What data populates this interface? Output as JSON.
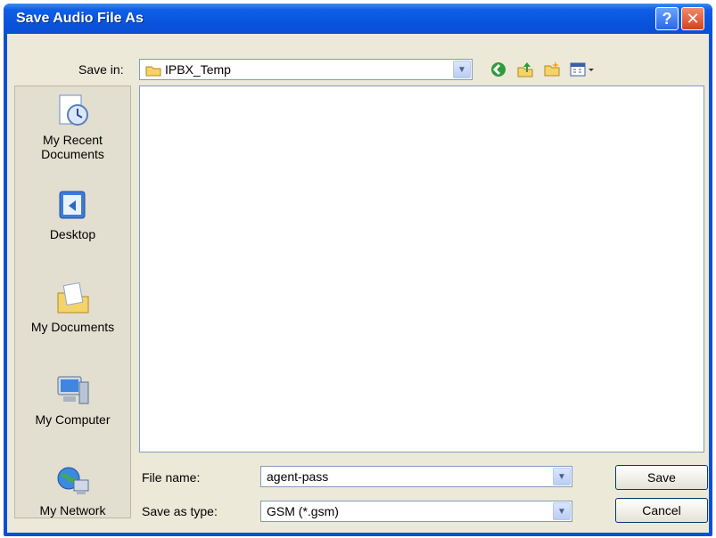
{
  "window": {
    "title": "Save Audio File As",
    "help_glyph": "?",
    "close_glyph": "✕"
  },
  "header": {
    "save_in_label": "Save in:",
    "save_in_value": "IPBX_Temp",
    "toolbar_icons": [
      "back-icon",
      "up-folder-icon",
      "new-folder-icon",
      "views-menu-icon"
    ]
  },
  "places": [
    {
      "label_line1": "My Recent",
      "label_line2": "Documents",
      "icon": "recent-documents-icon"
    },
    {
      "label_line1": "Desktop",
      "label_line2": "",
      "icon": "desktop-icon"
    },
    {
      "label_line1": "My Documents",
      "label_line2": "",
      "icon": "my-documents-icon"
    },
    {
      "label_line1": "My Computer",
      "label_line2": "",
      "icon": "my-computer-icon"
    },
    {
      "label_line1": "My Network",
      "label_line2": "",
      "icon": "my-network-icon"
    }
  ],
  "form": {
    "file_name_label": "File name:",
    "file_name_value": "agent-pass",
    "save_type_label": "Save as type:",
    "save_type_value": "GSM (*.gsm)"
  },
  "buttons": {
    "save": "Save",
    "cancel": "Cancel"
  },
  "colors": {
    "titlebar": "#0a4fd6",
    "dialog_bg": "#ece9d8",
    "close_button": "#d3421e"
  }
}
